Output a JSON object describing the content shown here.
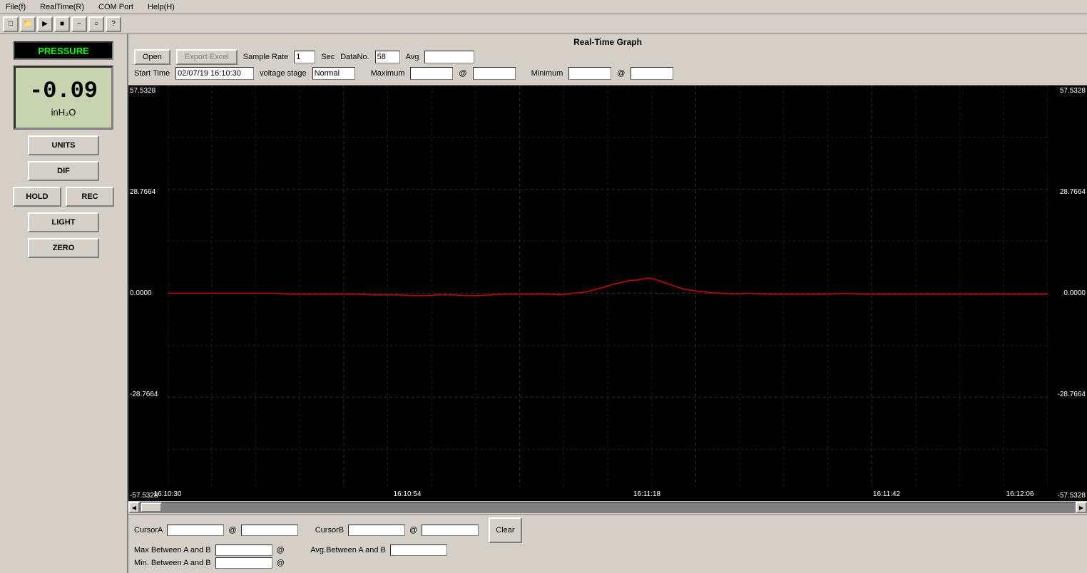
{
  "menubar": {
    "items": [
      "File(f)",
      "RealTime(R)",
      "COM Port",
      "Help(H)"
    ]
  },
  "toolbar": {
    "buttons": [
      "new",
      "open",
      "play",
      "stop",
      "minus",
      "info",
      "help"
    ]
  },
  "sidebar": {
    "pressure_label": "PRESSURE",
    "value": "-0.09",
    "unit": "inH₂O",
    "buttons": {
      "units": "UNITS",
      "dif": "DIF",
      "hold": "HOLD",
      "rec": "REC",
      "light": "LIGHT",
      "zero": "ZERO"
    }
  },
  "control": {
    "title": "Real-Time Graph",
    "open_label": "Open",
    "export_label": "Export Excel",
    "sample_rate_label": "Sample Rate",
    "sample_rate_value": "1",
    "sec_label": "Sec",
    "start_time_label": "Start Time",
    "start_time_value": "02/07/19 16:10:30",
    "voltage_stage_label": "voltage stage",
    "voltage_stage_value": "Normal",
    "datano_label": "DataNo.",
    "datano_value": "58",
    "avg_label": "Avg",
    "avg_value": "",
    "maximum_label": "Maximum",
    "maximum_value": "",
    "maximum_at": "@",
    "minimum_label": "Minimum",
    "minimum_value": "",
    "minimum_at": "@"
  },
  "graph": {
    "y_labels_left": [
      "57.5328",
      "28.7664",
      "0.0000",
      "-28.7664",
      "-57.5328"
    ],
    "y_labels_right": [
      "57.5328",
      "28.7664",
      "0.0000",
      "-28.7664",
      "-57.5328"
    ],
    "x_labels": [
      "16:10:30",
      "16:10:54",
      "16:11:18",
      "16:11:42",
      "16:12:06"
    ],
    "grid_color": "#1a1a1a",
    "line_color": "#cc0000"
  },
  "cursor_bar": {
    "cursor_a_label": "CursorA",
    "cursor_a_at": "@",
    "cursor_a_value": "",
    "cursor_b_label": "CursorB",
    "cursor_b_at": "@",
    "cursor_b_value": "",
    "clear_label": "Clear",
    "max_between_label": "Max Between A and B",
    "max_between_at": "@",
    "max_between_value": "",
    "avg_between_label": "Avg.Between A and B",
    "avg_between_value": "",
    "min_between_label": "Min. Between A and B",
    "min_between_at": "@",
    "min_between_value": ""
  }
}
